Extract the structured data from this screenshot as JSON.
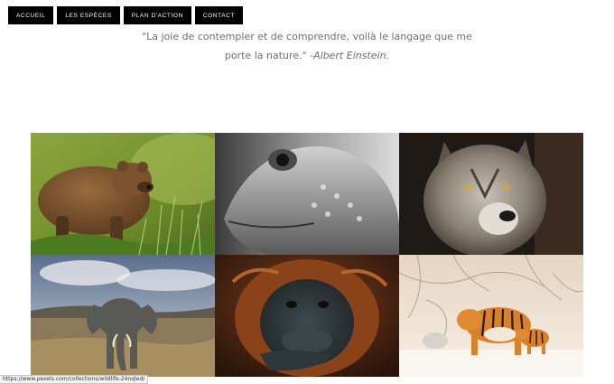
{
  "nav": {
    "items": [
      {
        "label": "Accueil"
      },
      {
        "label": "Les espèces"
      },
      {
        "label": "Plan d'action"
      },
      {
        "label": "Contact"
      }
    ]
  },
  "quote": {
    "text": "\"La joie de contempler et de comprendre, voilà le langage que me porte la nature.\"",
    "author": "-Albert Einstein."
  },
  "gallery": {
    "images": [
      {
        "subject": "brown bear on grass"
      },
      {
        "subject": "lizard in black and white"
      },
      {
        "subject": "grey wolf"
      },
      {
        "subject": "elephant in savanna"
      },
      {
        "subject": "orangutan"
      },
      {
        "subject": "tiger and cub in snow"
      }
    ]
  },
  "status_bar": {
    "url": "https://www.pexels.com/collections/wildlife-24nqled/"
  }
}
